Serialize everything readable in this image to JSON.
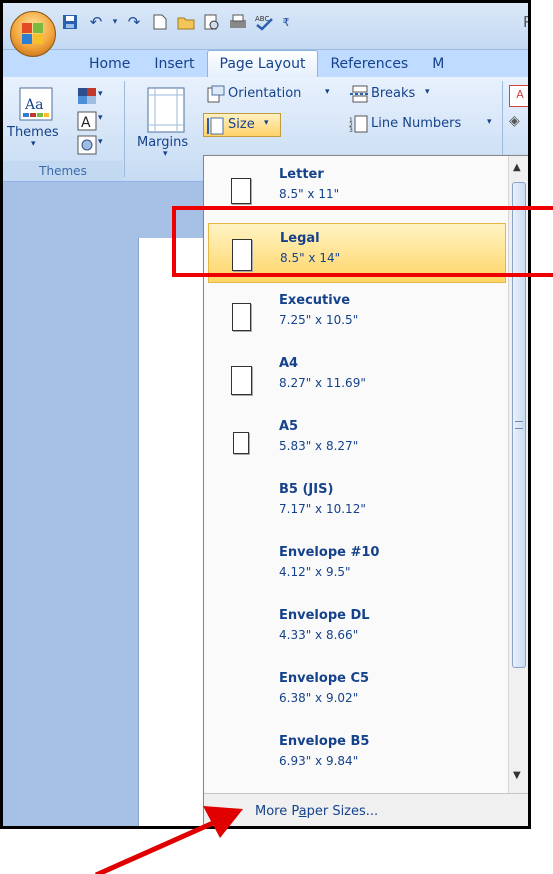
{
  "title_fragment": "P",
  "tabs": [
    {
      "label": "Home"
    },
    {
      "label": "Insert"
    },
    {
      "label": "Page Layout"
    },
    {
      "label": "References"
    },
    {
      "label": "M"
    }
  ],
  "ribbon": {
    "themes_label": "Themes",
    "themes_group": "Themes",
    "margins_label": "Margins",
    "orientation_label": "Orientation",
    "breaks_label": "Breaks",
    "size_label": "Size",
    "line_numbers_label": "Line Numbers"
  },
  "paper_sizes": [
    {
      "name": "Letter",
      "dims": "8.5\" x 11\""
    },
    {
      "name": "Legal",
      "dims": "8.5\" x 14\""
    },
    {
      "name": "Executive",
      "dims": "7.25\" x 10.5\""
    },
    {
      "name": "A4",
      "dims": "8.27\" x 11.69\""
    },
    {
      "name": "A5",
      "dims": "5.83\" x 8.27\""
    },
    {
      "name": "B5 (JIS)",
      "dims": "7.17\" x 10.12\""
    },
    {
      "name": "Envelope #10",
      "dims": "4.12\" x 9.5\""
    },
    {
      "name": "Envelope DL",
      "dims": "4.33\" x 8.66\""
    },
    {
      "name": "Envelope C5",
      "dims": "6.38\" x 9.02\""
    },
    {
      "name": "Envelope B5",
      "dims": "6.93\" x 9.84\""
    }
  ],
  "more_paper_sizes": {
    "pre": "More P",
    "accel": "a",
    "post": "per Sizes..."
  },
  "colors": {
    "annotation": "#e00000",
    "highlight": "#ffd565",
    "ribbon_text": "#15428b"
  }
}
